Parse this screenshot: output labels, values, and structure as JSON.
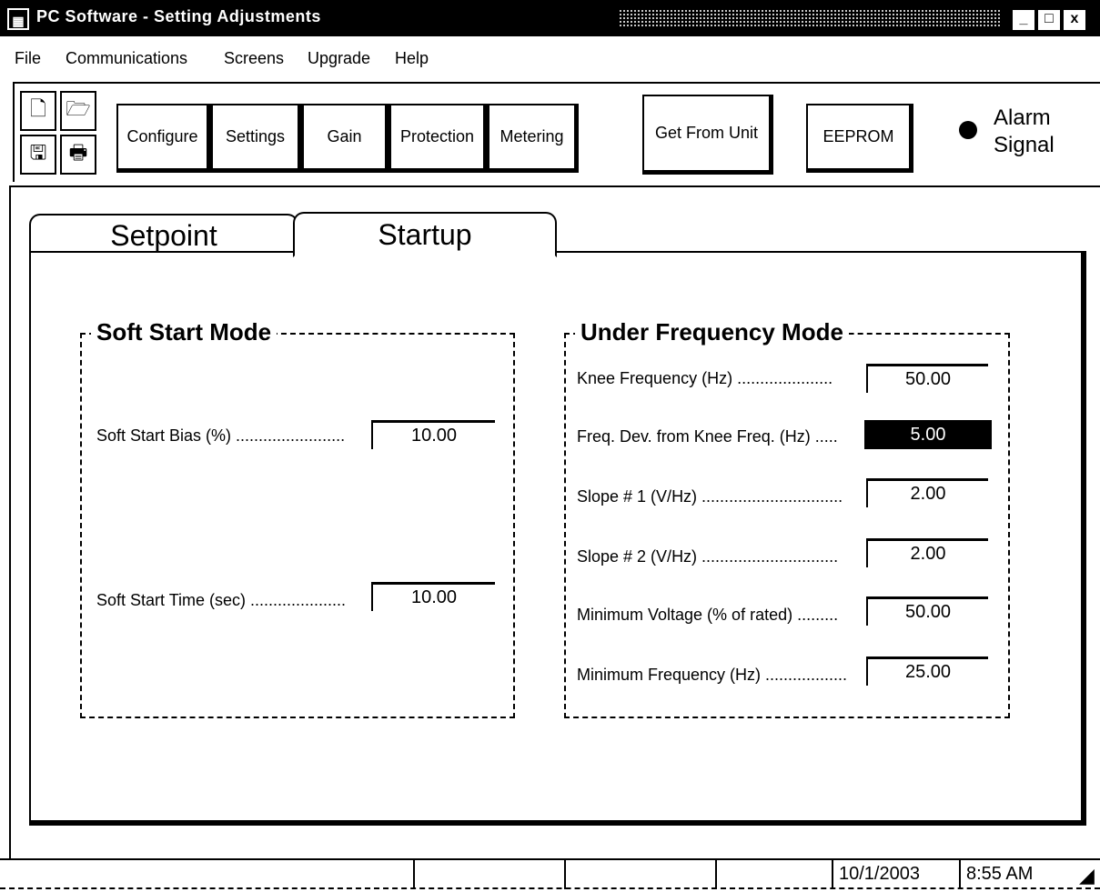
{
  "window": {
    "title": "PC Software - Setting Adjustments",
    "controls": {
      "minimize": "_",
      "maximize": "□",
      "close": "x"
    }
  },
  "menu": [
    "File",
    "Communications",
    "Screens",
    "Upgrade",
    "Help"
  ],
  "toolbar": {
    "buttons": [
      "Configure",
      "Settings",
      "Gain",
      "Protection",
      "Metering"
    ],
    "get_from_unit": "Get From Unit",
    "eeprom": "EEPROM",
    "alarm_label_line1": "Alarm",
    "alarm_label_line2": "Signal"
  },
  "tabs": [
    "Setpoint",
    "Startup"
  ],
  "active_tab": "Startup",
  "soft_start": {
    "title": "Soft Start Mode",
    "fields": [
      {
        "label": "Soft Start Bias (%) ........................",
        "value": "10.00"
      },
      {
        "label": "Soft Start Time (sec) .....................",
        "value": "10.00"
      }
    ]
  },
  "under_frequency": {
    "title": "Under Frequency Mode",
    "fields": [
      {
        "label": "Knee Frequency (Hz) .....................",
        "value": "50.00"
      },
      {
        "label": "Freq. Dev. from Knee Freq. (Hz) .....",
        "value": "5.00"
      },
      {
        "label": "Slope # 1 (V/Hz) ...............................",
        "value": "2.00"
      },
      {
        "label": "Slope # 2 (V/Hz) ..............................",
        "value": "2.00"
      },
      {
        "label": "Minimum Voltage (% of rated) .........",
        "value": "50.00"
      },
      {
        "label": "Minimum Frequency (Hz) ..................",
        "value": "25.00"
      }
    ]
  },
  "status": {
    "date": "10/1/2003",
    "time": "8:55 AM"
  }
}
